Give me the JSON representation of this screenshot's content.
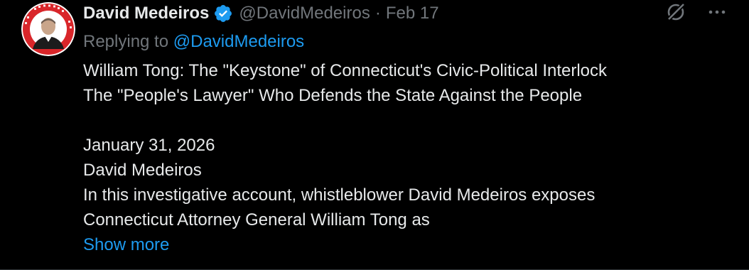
{
  "tweet": {
    "author": {
      "name": "David Medeiros",
      "handle": "@DavidMedeiros",
      "verified": true,
      "avatar_icon": "avatar-photo",
      "avatar_badge_text": "A&J RESOURCES"
    },
    "separator": "·",
    "date": "Feb 17",
    "reply": {
      "prefix": "Replying to",
      "mention": "@DavidMedeiros"
    },
    "lines": [
      "William Tong: The \"Keystone\" of Connecticut's Civic-Political Interlock",
      "The \"People's Lawyer\" Who Defends the State Against the People",
      "",
      "January 31, 2026",
      "David Medeiros",
      "In this investigative account, whistleblower David Medeiros exposes",
      "Connecticut Attorney General William Tong as"
    ],
    "show_more": "Show more",
    "icons": {
      "verified": "verified-badge-icon",
      "grok": "grok-icon",
      "more": "more-icon"
    },
    "colors": {
      "background": "#000000",
      "text": "#e7e9ea",
      "secondary": "#71767b",
      "accent": "#1d9bf0"
    }
  }
}
